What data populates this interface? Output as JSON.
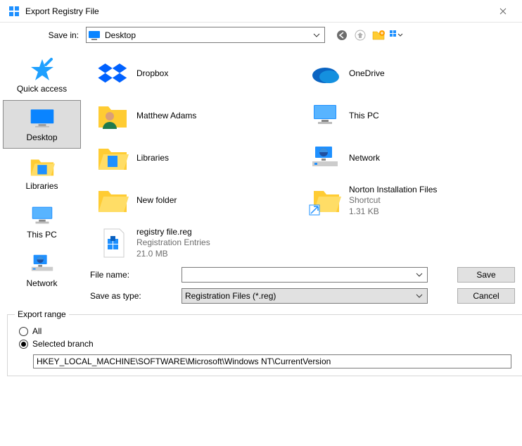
{
  "window": {
    "title": "Export Registry File"
  },
  "topbar": {
    "savein_label": "Save in:",
    "location": "Desktop"
  },
  "sidebar": {
    "items": [
      {
        "label": "Quick access"
      },
      {
        "label": "Desktop"
      },
      {
        "label": "Libraries"
      },
      {
        "label": "This PC"
      },
      {
        "label": "Network"
      }
    ]
  },
  "files": [
    {
      "name": "Dropbox"
    },
    {
      "name": "OneDrive"
    },
    {
      "name": "Matthew Adams"
    },
    {
      "name": "This PC"
    },
    {
      "name": "Libraries"
    },
    {
      "name": "Network"
    },
    {
      "name": "New folder"
    },
    {
      "name": "Norton Installation Files",
      "sub1": "Shortcut",
      "sub2": "1.31 KB"
    },
    {
      "name": "registry file.reg",
      "sub1": "Registration Entries",
      "sub2": "21.0 MB"
    }
  ],
  "controls": {
    "filename_label": "File name:",
    "filename_value": "",
    "saveastype_label": "Save as type:",
    "saveastype_value": "Registration Files (*.reg)",
    "save_label": "Save",
    "cancel_label": "Cancel"
  },
  "export_range": {
    "legend": "Export range",
    "all_label": "All",
    "selected_label": "Selected branch",
    "branch_value": "HKEY_LOCAL_MACHINE\\SOFTWARE\\Microsoft\\Windows NT\\CurrentVersion"
  }
}
